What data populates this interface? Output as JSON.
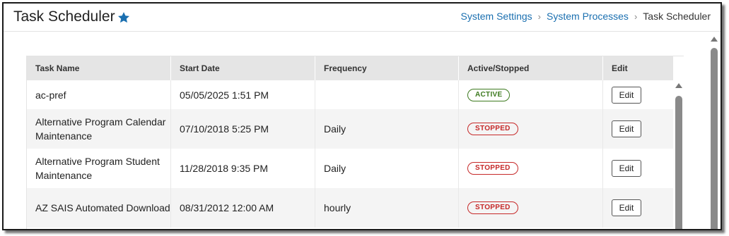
{
  "header": {
    "title": "Task Scheduler",
    "favorite_icon": "star-icon",
    "breadcrumb": [
      {
        "label": "System Settings"
      },
      {
        "label": "System Processes"
      },
      {
        "label": "Task Scheduler"
      }
    ]
  },
  "table": {
    "columns": [
      "Task Name",
      "Start Date",
      "Frequency",
      "Active/Stopped",
      "Edit"
    ],
    "rows": [
      {
        "name": "ac-pref",
        "start_date": "05/05/2025 1:51 PM",
        "frequency": "",
        "status": "ACTIVE",
        "edit_label": "Edit"
      },
      {
        "name": "Alternative Program Calendar Maintenance",
        "start_date": "07/10/2018 5:25 PM",
        "frequency": "Daily",
        "status": "STOPPED",
        "edit_label": "Edit"
      },
      {
        "name": "Alternative Program Student Maintenance",
        "start_date": "11/28/2018 9:35 PM",
        "frequency": "Daily",
        "status": "STOPPED",
        "edit_label": "Edit"
      },
      {
        "name": "AZ SAIS Automated Download",
        "start_date": "08/31/2012 12:00 AM",
        "frequency": "hourly",
        "status": "STOPPED",
        "edit_label": "Edit"
      }
    ]
  },
  "colors": {
    "link": "#1a6fb0",
    "star": "#1a6fb0",
    "active": "#3d7a1f",
    "stopped": "#c62828",
    "header_bg": "#e5e5e5"
  }
}
